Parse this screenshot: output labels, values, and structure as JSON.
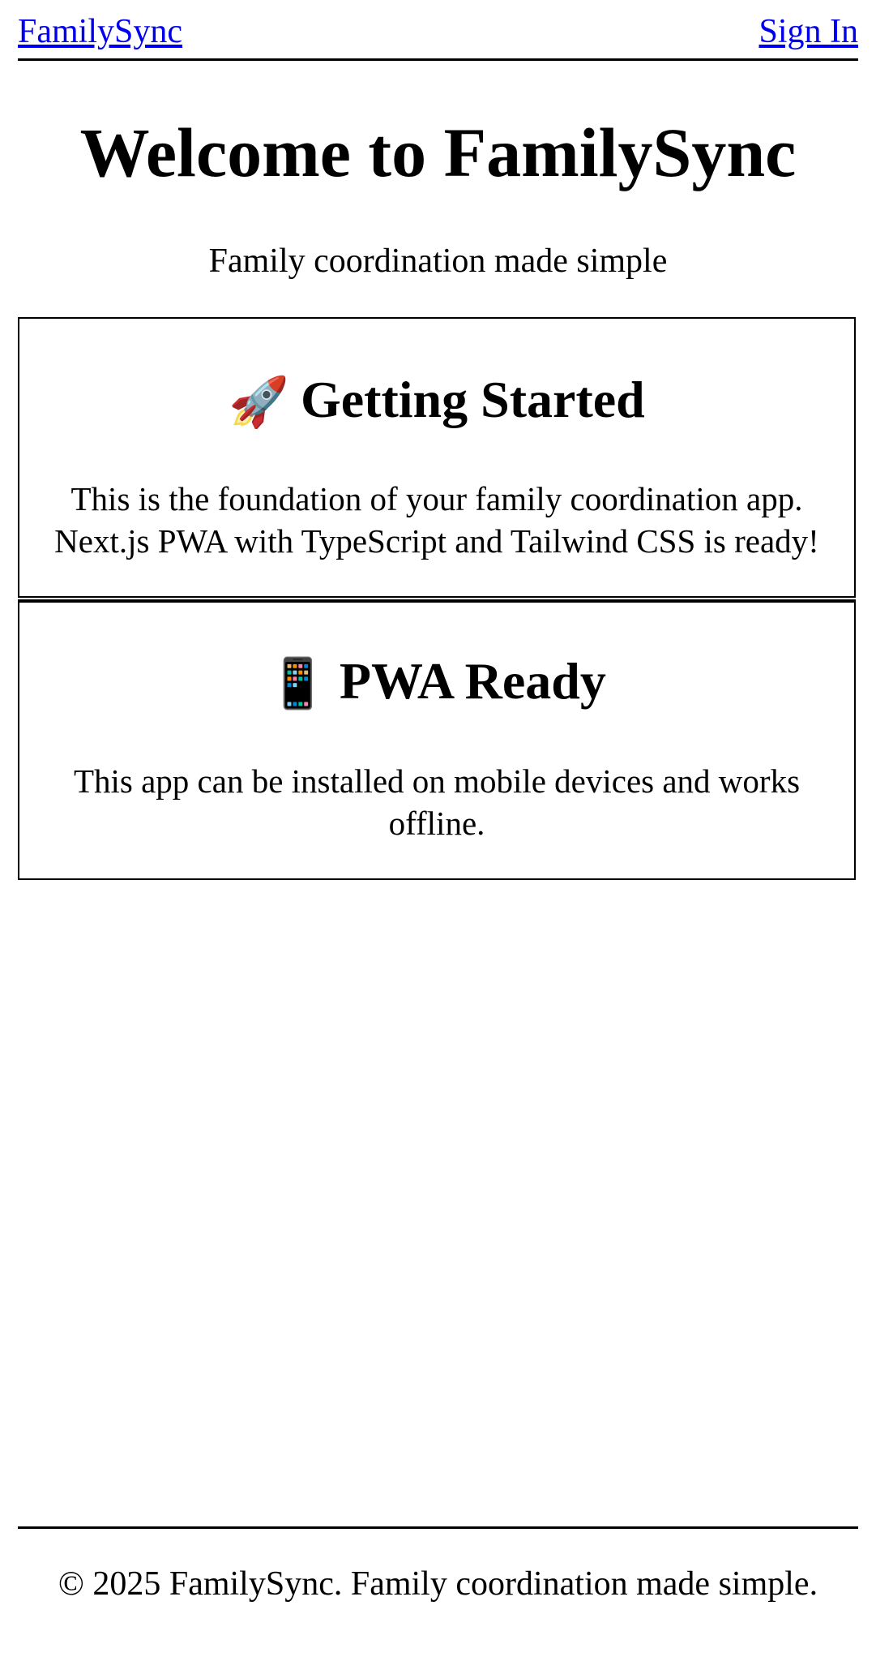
{
  "nav": {
    "brand_link": "FamilySync",
    "signin_link": "Sign In"
  },
  "hero": {
    "title": "Welcome to FamilySync",
    "subtitle": "Family coordination made simple"
  },
  "cards": [
    {
      "icon": "rocket-icon",
      "icon_glyph": "🚀",
      "heading": "Getting Started",
      "body": "This is the foundation of your family coordination app. Next.js PWA with TypeScript and Tailwind CSS is ready!"
    },
    {
      "icon": "mobile-phone-icon",
      "icon_glyph": "📱",
      "heading": "PWA Ready",
      "body": "This app can be installed on mobile devices and works offline."
    }
  ],
  "footer": {
    "text": "© 2025 FamilySync. Family coordination made simple."
  },
  "colors": {
    "link": "#0000ee",
    "text": "#000000",
    "background": "#ffffff"
  }
}
